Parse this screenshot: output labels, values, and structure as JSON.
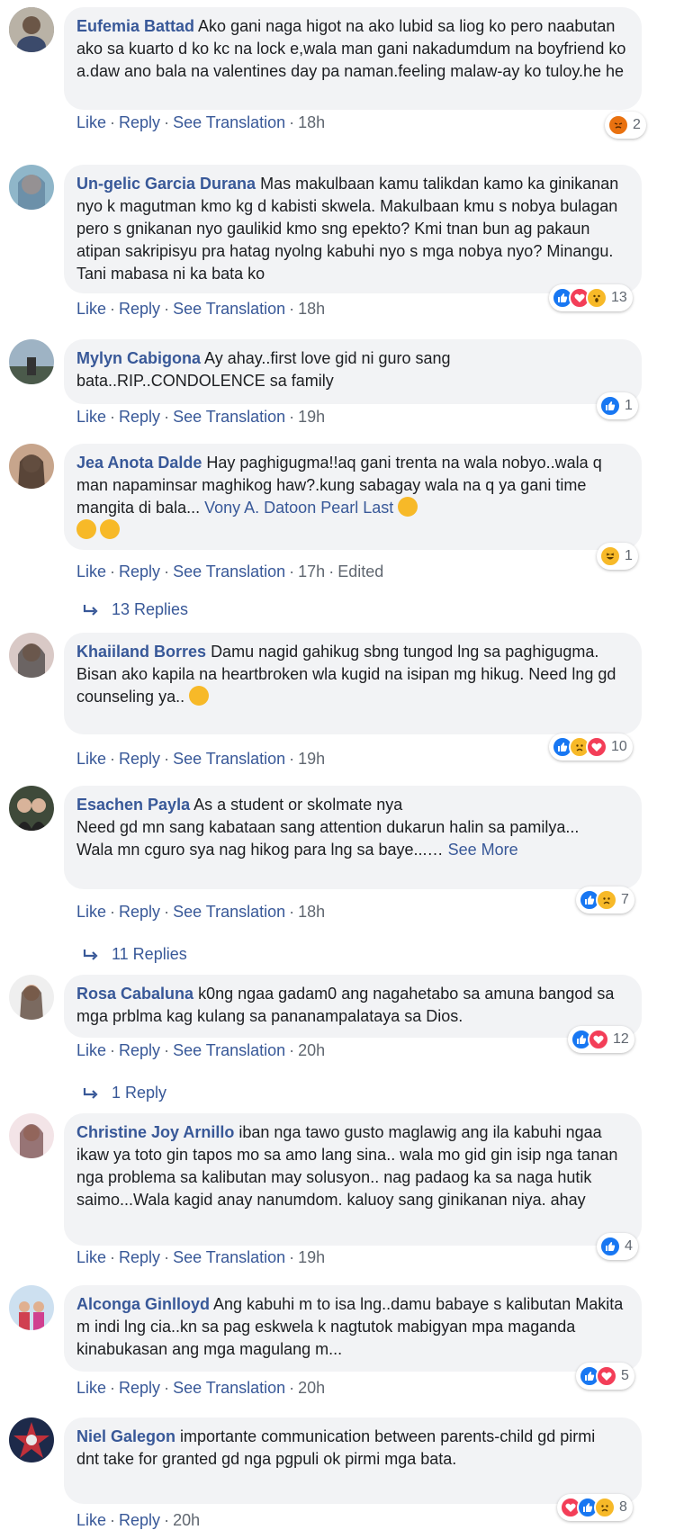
{
  "labels": {
    "like": "Like",
    "reply": "Reply",
    "see_translation": "See Translation",
    "edited": "Edited",
    "sep": "·"
  },
  "comments": [
    {
      "name": "Eufemia Battad",
      "text": "Ako gani naga higot na ako lubid sa liog ko pero naabutan ako sa kuarto d ko kc na lock e,wala man gani nakadumdum na boyfriend ko a.daw ano bala na valentines day pa naman.feeling malaw-ay ko tuloy.he he",
      "time": "18h",
      "reactions": "2"
    },
    {
      "name": "Un-gelic Garcia Durana",
      "text": "Mas makulbaan kamu talikdan kamo ka ginikanan nyo k magutman kmo kg d kabisti skwela. Makulbaan kmu s nobya bulagan pero s gnikanan nyo gaulikid kmo sng epekto? Kmi tnan bun ag pakaun atipan sakripisyu pra hatag nyolng kabuhi nyo s mga nobya nyo? Minangu. Tani mabasa ni ka bata ko",
      "time": "18h",
      "reactions": "13"
    },
    {
      "name": "Mylyn Cabigona",
      "text": "Ay ahay..first love gid ni guro sang bata..RIP..CONDOLENCE sa family",
      "time": "19h",
      "reactions": "1"
    },
    {
      "name": "Jea Anota Dalde",
      "text": "Hay paghigugma!!aq gani trenta na wala nobyo..wala q man napaminsar maghikog haw?.kung sabagay wala na q ya gani time mangita di bala...",
      "tag": "Vony A. Datoon Pearl Last",
      "time": "17h",
      "reactions": "1",
      "replies": "13 Replies"
    },
    {
      "name": "Khaiiland Borres",
      "text": "Damu nagid gahikug sbng tungod lng sa paghigugma.",
      "text2": "Bisan ako kapila na heartbroken wla kugid na isipan mg hikug. Need lng gd counseling ya..",
      "time": "19h",
      "reactions": "10"
    },
    {
      "name": "Esachen Payla",
      "text": "As a student or skolmate nya",
      "text2": "Need gd mn sang kabataan sang attention dukarun halin sa pamilya...",
      "text3": "Wala mn cguro sya nag hikog para lng sa baye...…",
      "more": "See More",
      "time": "18h",
      "reactions": "7",
      "replies": "11 Replies"
    },
    {
      "name": "Rosa Cabaluna",
      "text": "k0ng ngaa gadam0 ang nagahetabo sa amuna bangod sa mga prblma kag kulang sa pananampalataya sa Dios.",
      "time": "20h",
      "reactions": "12",
      "replies": "1 Reply"
    },
    {
      "name": "Christine Joy Arnillo",
      "text": "iban nga tawo gusto maglawig ang ila kabuhi ngaa ikaw ya toto gin tapos mo sa amo lang sina.. wala mo gid gin isip nga tanan nga problema sa kalibutan may solusyon.. nag padaog ka sa naga hutik saimo...Wala kagid anay nanumdom. kaluoy sang ginikanan niya. ahay",
      "time": "19h",
      "reactions": "4"
    },
    {
      "name": "Alconga Ginlloyd",
      "text": "Ang kabuhi m to isa lng..damu babaye s kalibutan Makita m indi lng cia..kn sa pag eskwela k nagtutok mabigyan mpa maganda kinabukasan ang mga magulang m...",
      "time": "20h",
      "reactions": "5"
    },
    {
      "name": "Niel Galegon",
      "text": "importante communication between parents-child gd pirmi",
      "text2": "dnt take for granted gd nga pgpuli ok pirmi mga bata.",
      "time": "20h",
      "reactions": "8"
    }
  ]
}
